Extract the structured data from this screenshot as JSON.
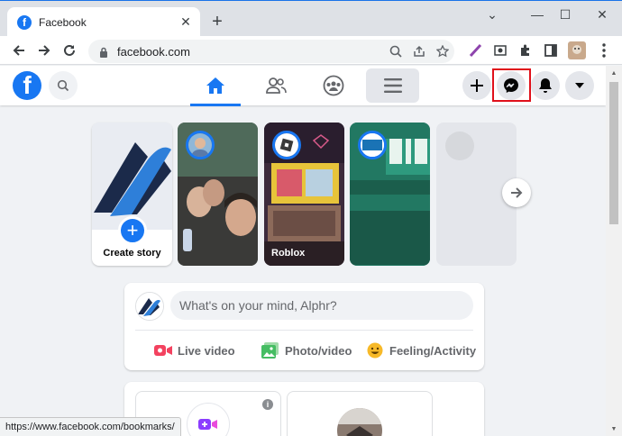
{
  "browser": {
    "tab_title": "Facebook",
    "tab_close": "✕",
    "new_tab": "+",
    "url": "facebook.com",
    "status_url": "https://www.facebook.com/bookmarks/",
    "icons": [
      "back-icon",
      "forward-icon",
      "reload-icon",
      "lock-icon",
      "zoom-icon",
      "share-icon",
      "star-icon",
      "extensions-icon",
      "profile-icon",
      "menu-icon"
    ]
  },
  "window_controls": {
    "chevron": "⌄",
    "minimize": "—",
    "maximize": "☐",
    "close": "✕"
  },
  "facebook": {
    "brand_color": "#1877f2",
    "logo_letter": "f",
    "nav_tabs": [
      "home",
      "friends",
      "groups",
      "menu"
    ],
    "header_actions": [
      "create",
      "messenger",
      "notifications",
      "account"
    ],
    "highlighted_action": "messenger",
    "stories": {
      "create_label": "Create story",
      "items": [
        {
          "name": ""
        },
        {
          "name": "Roblox"
        },
        {
          "name": ""
        },
        {
          "name": ""
        }
      ]
    },
    "composer": {
      "placeholder": "What's on your mind, Alphr?",
      "actions": [
        {
          "label": "Live video",
          "color": "#f3425f"
        },
        {
          "label": "Photo/video",
          "color": "#45bd62"
        },
        {
          "label": "Feeling/Activity",
          "color": "#f7b928"
        }
      ]
    },
    "rooms": {
      "info": "i"
    }
  }
}
